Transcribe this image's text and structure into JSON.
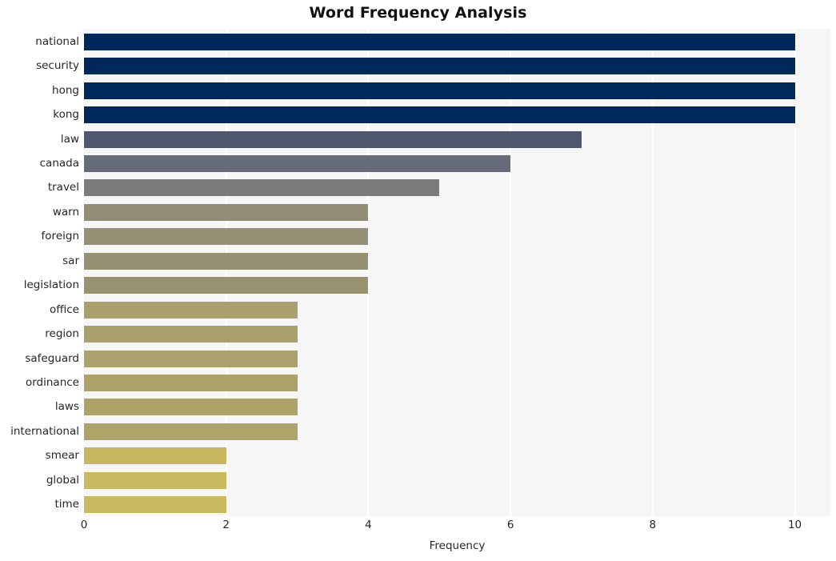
{
  "chart_data": {
    "type": "bar",
    "orientation": "horizontal",
    "title": "Word Frequency Analysis",
    "xlabel": "Frequency",
    "ylabel": "",
    "categories": [
      "national",
      "security",
      "hong",
      "kong",
      "law",
      "canada",
      "travel",
      "warn",
      "foreign",
      "sar",
      "legislation",
      "office",
      "region",
      "safeguard",
      "ordinance",
      "laws",
      "international",
      "smear",
      "global",
      "time"
    ],
    "values": [
      10,
      10,
      10,
      10,
      7,
      6,
      5,
      4,
      4,
      4,
      4,
      3,
      3,
      3,
      3,
      3,
      3,
      2,
      2,
      2
    ],
    "bar_colors": [
      "#00285a",
      "#00285a",
      "#00295b",
      "#002a5c",
      "#4e576e",
      "#666b7a",
      "#7b7b7b",
      "#928d76",
      "#948f75",
      "#969073",
      "#989271",
      "#aaa06b",
      "#aaa06b",
      "#aba16a",
      "#aca269",
      "#ada368",
      "#aea467",
      "#c7b85f",
      "#c8b95e",
      "#c8b95e"
    ],
    "xlim": [
      0,
      10.5
    ],
    "xticks": [
      0,
      2,
      4,
      6,
      8,
      10
    ],
    "xtick_labels": [
      "0",
      "2",
      "4",
      "6",
      "8",
      "10"
    ],
    "grid": "vertical-white",
    "plot_background": "#f6f6f6",
    "figure_background": "#ffffff",
    "legend": null,
    "colormap": "cividis-reversed"
  }
}
